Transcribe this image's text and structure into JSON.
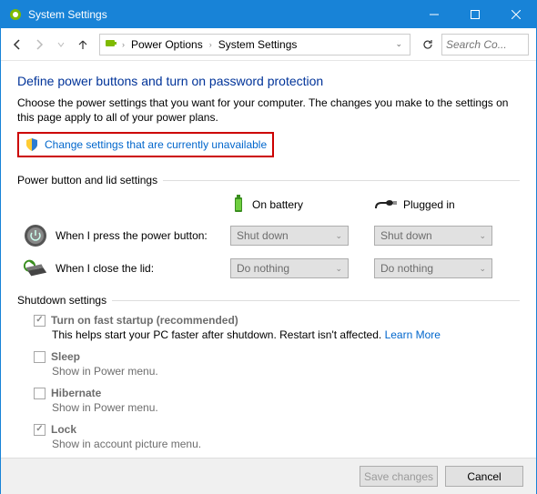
{
  "window": {
    "title": "System Settings"
  },
  "breadcrumb": {
    "level1": "Power Options",
    "level2": "System Settings"
  },
  "search": {
    "placeholder": "Search Co..."
  },
  "page": {
    "heading": "Define power buttons and turn on password protection",
    "description": "Choose the power settings that you want for your computer. The changes you make to the settings on this page apply to all of your power plans.",
    "change_link": "Change settings that are currently unavailable"
  },
  "sections": {
    "power_button_lid": "Power button and lid settings",
    "shutdown": "Shutdown settings"
  },
  "columns": {
    "battery": "On battery",
    "plugged": "Plugged in"
  },
  "rows": {
    "power_button": {
      "label": "When I press the power button:",
      "battery": "Shut down",
      "plugged": "Shut down"
    },
    "close_lid": {
      "label": "When I close the lid:",
      "battery": "Do nothing",
      "plugged": "Do nothing"
    }
  },
  "shutdown_options": {
    "fast_startup": {
      "label": "Turn on fast startup (recommended)",
      "desc": "This helps start your PC faster after shutdown. Restart isn't affected. ",
      "learn": "Learn More",
      "checked": true
    },
    "sleep": {
      "label": "Sleep",
      "desc": "Show in Power menu.",
      "checked": false
    },
    "hibernate": {
      "label": "Hibernate",
      "desc": "Show in Power menu.",
      "checked": false
    },
    "lock": {
      "label": "Lock",
      "desc": "Show in account picture menu.",
      "checked": true
    }
  },
  "buttons": {
    "save": "Save changes",
    "cancel": "Cancel"
  }
}
